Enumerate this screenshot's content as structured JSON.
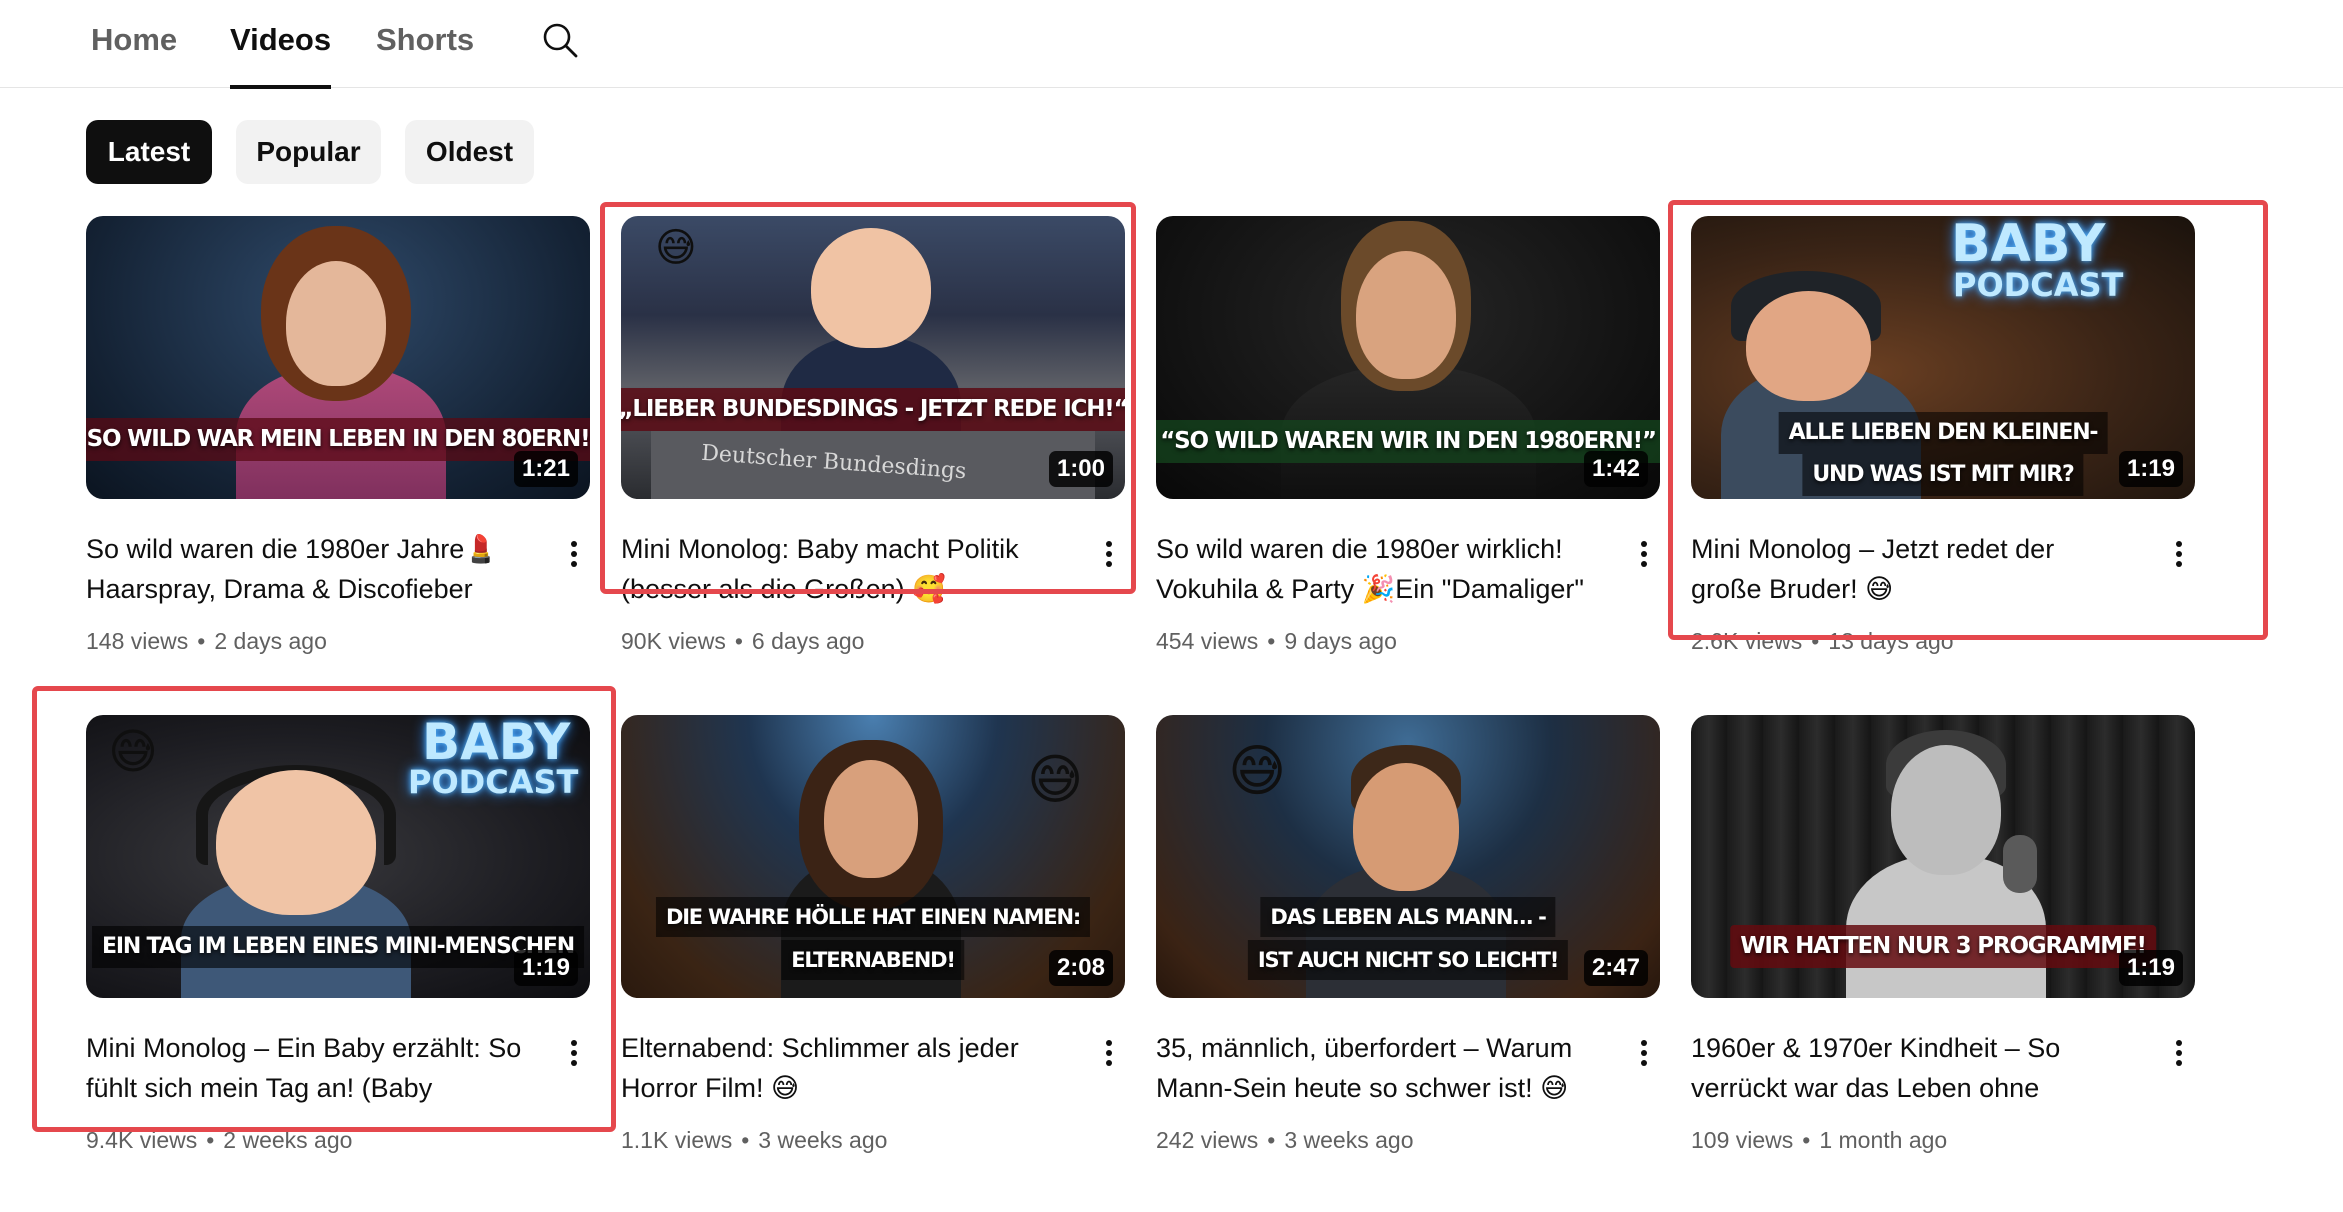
{
  "tabs": [
    {
      "label": "Home",
      "active": false
    },
    {
      "label": "Videos",
      "active": true
    },
    {
      "label": "Shorts",
      "active": false
    }
  ],
  "search": {
    "icon": "search-icon"
  },
  "filters": [
    {
      "label": "Latest",
      "active": true
    },
    {
      "label": "Popular",
      "active": false
    },
    {
      "label": "Oldest",
      "active": false
    }
  ],
  "videos": [
    {
      "title": "So wild waren die 1980er Jahre💄 Haarspray, Drama & Discofieber",
      "views": "148 views",
      "age": "2 days ago",
      "duration": "1:21",
      "thumb_text": "„SO WILD WAR MEIN LEBEN IN DEN 80ERN!“",
      "highlighted": false
    },
    {
      "title": "Mini Monolog: Baby macht Politik (besser als die Großen) 🥰",
      "views": "90K views",
      "age": "6 days ago",
      "duration": "1:00",
      "thumb_text": "„LIEBER BUNDESDINGS - JETZT REDE ICH!“",
      "thumb_sign": "Deutscher Bundesdings",
      "thumb_emoji": "😅",
      "highlighted": true
    },
    {
      "title": "So wild waren die 1980er wirklich! Vokuhila & Party 🎉Ein \"Damaliger\" erzählt…",
      "views": "454 views",
      "age": "9 days ago",
      "duration": "1:42",
      "thumb_text": "“SO WILD WAREN WIR IN DEN 1980ERN!”",
      "highlighted": false
    },
    {
      "title": "Mini Monolog – Jetzt redet der große Bruder! 😅",
      "views": "2.6K views",
      "age": "13 days ago",
      "duration": "1:19",
      "thumb_text_lines": [
        "ALLE LIEBEN DEN KLEINEN-",
        "UND WAS IST MIT MIR?"
      ],
      "thumb_neon": [
        "BABY",
        "PODCAST"
      ],
      "highlighted": true
    },
    {
      "title": "Mini Monolog – Ein Baby erzählt: So fühlt sich mein Tag an! (Baby Podcast)",
      "views": "9.4K views",
      "age": "2 weeks ago",
      "duration": "1:19",
      "thumb_text": "EIN TAG IM LEBEN EINES MINI-MENSCHEN",
      "thumb_neon": [
        "BABY",
        "PODCAST"
      ],
      "thumb_emoji": "😅",
      "highlighted": true
    },
    {
      "title": "Elternabend: Schlimmer als jeder Horror Film! 😅",
      "views": "1.1K views",
      "age": "3 weeks ago",
      "duration": "2:08",
      "thumb_text_lines": [
        "DIE WAHRE HÖLLE HAT EINEN NAMEN:",
        "ELTERNABEND!"
      ],
      "thumb_emoji": "😅",
      "highlighted": false
    },
    {
      "title": "35, männlich, überfordert – Warum Mann-Sein heute so schwer ist! 😅",
      "views": "242 views",
      "age": "3 weeks ago",
      "duration": "2:47",
      "thumb_text_lines": [
        "DAS LEBEN ALS MANN… -",
        "IST AUCH NICHT SO LEICHT!"
      ],
      "thumb_emoji": "😅",
      "highlighted": false
    },
    {
      "title": "1960er & 1970er Kindheit – So verrückt war das Leben ohne Handy!",
      "views": "109 views",
      "age": "1 month ago",
      "duration": "1:19",
      "thumb_text": "WIR HATTEN NUR 3 PROGRAMME!",
      "highlighted": false
    }
  ],
  "colors": {
    "highlight": "#e5484d",
    "chip_active_bg": "#0f0f0f",
    "chip_bg": "#f2f2f2",
    "meta_text": "#606060"
  }
}
